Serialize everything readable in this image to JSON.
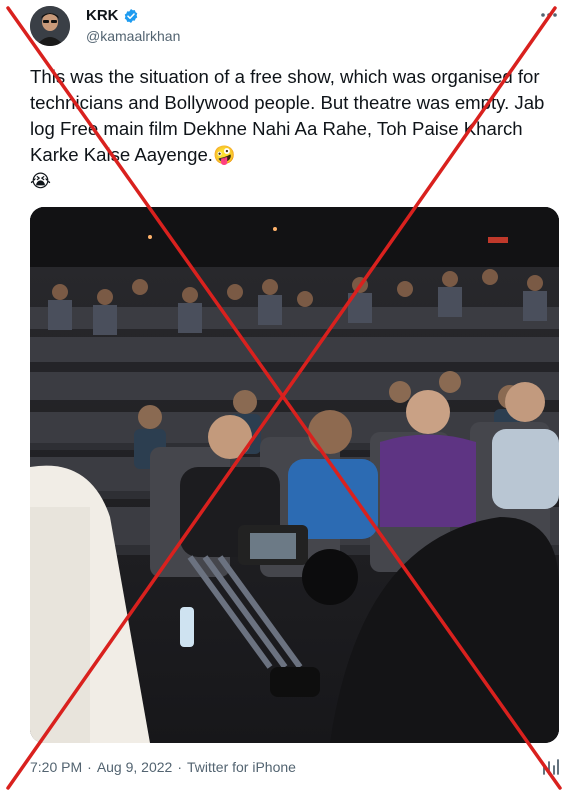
{
  "tweet": {
    "display_name": "KRK",
    "handle": "@kamaalrkhan",
    "text": "This was the situation of a free show, which was organised for technicians and Bollywood people. But theatre was empty. Jab log Free main film Dekhne Nahi Aa Rahe, Toh Paise Kharch Karke Kaise Aayenge.",
    "emoji_1": "🤪",
    "emoji_2": "😭",
    "time": "7:20 PM",
    "separator": "·",
    "date": "Aug 9, 2022",
    "source": "Twitter for iPhone"
  },
  "icons": {
    "verified": "verified-badge-icon",
    "more": "more-options-icon",
    "analytics": "analytics-icon"
  },
  "colors": {
    "verified_blue": "#1d9bf0",
    "text_secondary": "#536471",
    "overlay_cross": "#d9211e"
  }
}
